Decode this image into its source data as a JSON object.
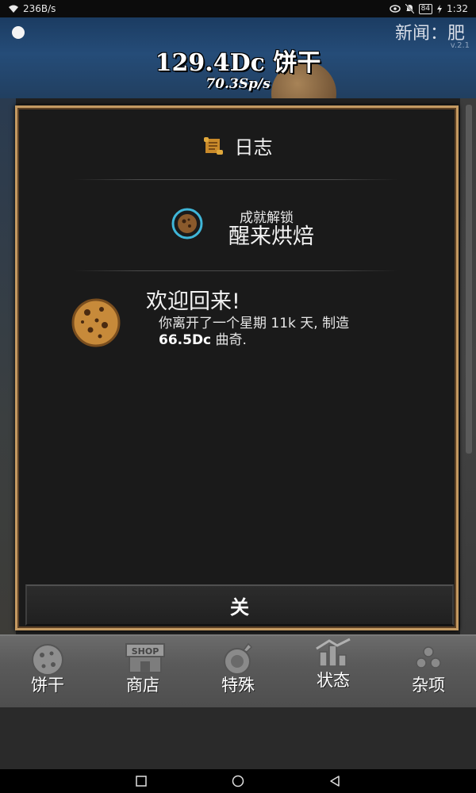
{
  "status_bar": {
    "network_speed": "236B/s",
    "battery": "84",
    "time": "1:32"
  },
  "header": {
    "news": "新闻：肥",
    "version": "v.2.1",
    "cookie_count": "129.4Dc 饼干",
    "cps": "70.3Sp/s"
  },
  "dialog": {
    "title": "日志",
    "achievement_label": "成就解锁",
    "achievement_name": "醒来烘焙",
    "welcome_title": "欢迎回来!",
    "welcome_line1": "你离开了一个星期 11k 天, 制造",
    "produced_amount": "66.5Dc",
    "produced_suffix": " 曲奇.",
    "close_label": "关"
  },
  "tabs": [
    {
      "label": "饼干",
      "icon": "cookie-icon"
    },
    {
      "label": "商店",
      "icon": "shop-icon"
    },
    {
      "label": "特殊",
      "icon": "special-icon"
    },
    {
      "label": "状态",
      "icon": "stats-icon"
    },
    {
      "label": "杂项",
      "icon": "misc-icon"
    }
  ],
  "shop_sign": "SHOP",
  "colors": {
    "dialog_border": "#c49a62",
    "header_blue": "#254c78",
    "tabbar": "#5a5a5a"
  }
}
